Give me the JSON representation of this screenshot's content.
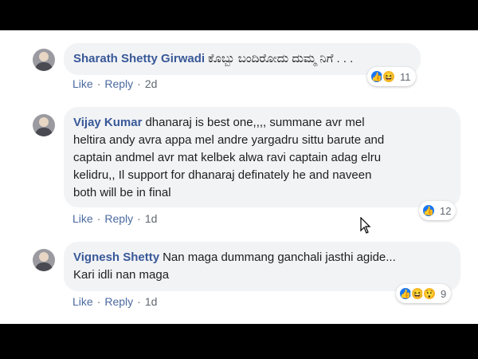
{
  "comments": [
    {
      "author": "Sharath Shetty Girwadi",
      "text": "ಕೊಬ್ಬು ಬಂದಿರೋದು ದುಮ್ಮ ನಿಗೆ . . .",
      "like": "Like",
      "reply": "Reply",
      "time": "2d",
      "reactions": [
        "like-icon",
        "haha-icon"
      ],
      "count": "11"
    },
    {
      "author": "Vijay Kumar",
      "text": "dhanaraj is best one,,,, summane avr mel\nheltira andy avra appa mel andre yargadru sittu barute and\ncaptain andmel avr mat kelbek alwa ravi captain adag elru\nkelidru,, Il support for dhanaraj definately he and naveen\nboth will be in final",
      "like": "Like",
      "reply": "Reply",
      "time": "1d",
      "reactions": [
        "like-icon"
      ],
      "count": "12"
    },
    {
      "author": "Vignesh Shetty",
      "text": "Nan maga dummang ganchali jasthi agide...\nKari idli nan maga",
      "like": "Like",
      "reply": "Reply",
      "time": "1d",
      "reactions": [
        "like-icon",
        "haha-icon",
        "wow-icon"
      ],
      "count": "9"
    }
  ],
  "colors": {
    "author": "#385898",
    "link": "#4b6aa0",
    "bubble": "#f2f3f5",
    "like": "#1877f2",
    "emoji": "#f7b928"
  }
}
